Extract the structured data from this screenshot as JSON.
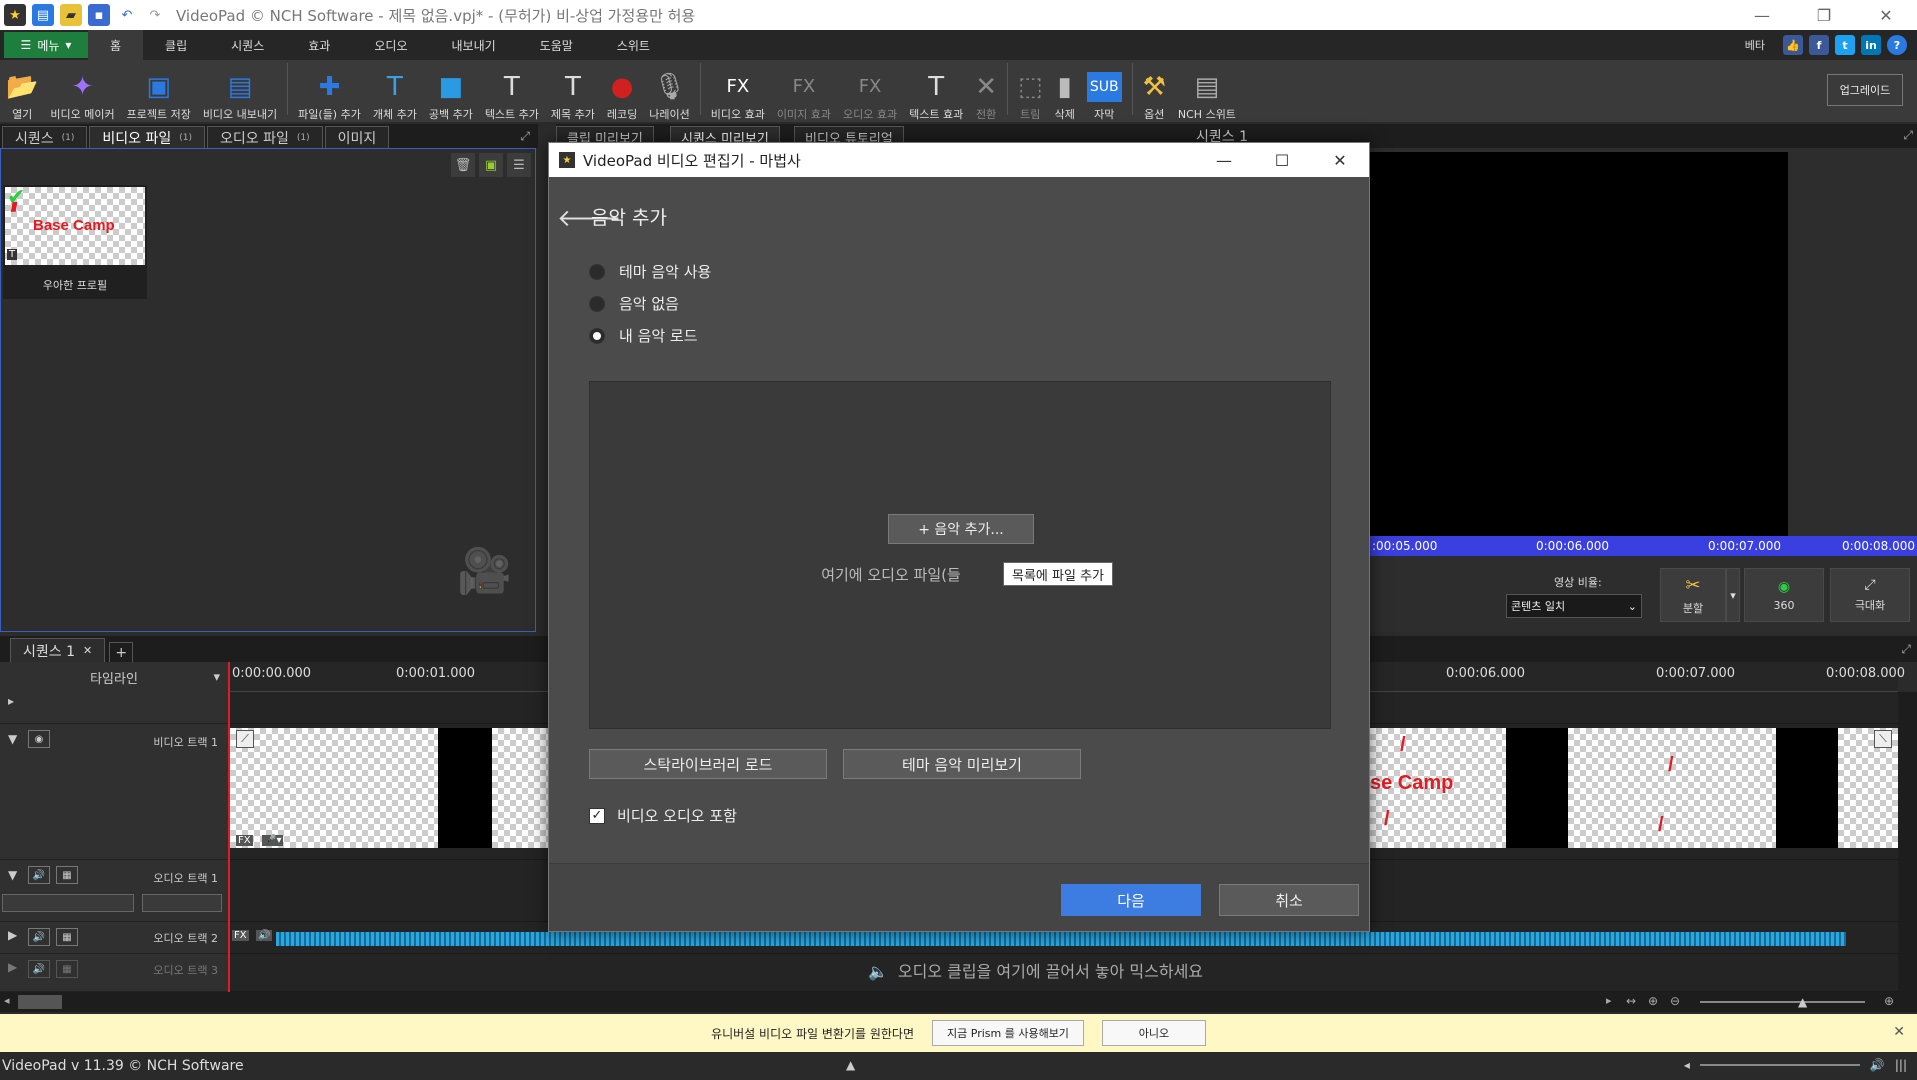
{
  "app": {
    "window_title": "VideoPad © NCH Software - 제목 없음.vpj* - (무허가) 비-상업 가정용만 허용"
  },
  "menu": {
    "menu_label": "메뉴",
    "tabs": [
      "홈",
      "클립",
      "시퀀스",
      "효과",
      "오디오",
      "내보내기",
      "도움말",
      "스위트"
    ],
    "active_tab": "홈",
    "beta_label": "베타"
  },
  "toolbar": {
    "items": [
      {
        "label": "열기",
        "icon": "folder-open-icon",
        "glyph": "📂"
      },
      {
        "label": "비디오 메이커",
        "icon": "wizard-icon",
        "glyph": "🧙"
      },
      {
        "label": "프로젝트 저장",
        "icon": "save-icon",
        "glyph": "💾"
      },
      {
        "label": "비디오 내보내기",
        "icon": "export-video-icon",
        "glyph": "🎞"
      },
      {
        "label": "파일(들) 추가",
        "icon": "add-file-icon",
        "glyph": "➕"
      },
      {
        "label": "개체 추가",
        "icon": "add-object-icon",
        "glyph": "T"
      },
      {
        "label": "공백 추가",
        "icon": "add-blank-icon",
        "glyph": "▣"
      },
      {
        "label": "텍스트 추가",
        "icon": "add-text-icon",
        "glyph": "T"
      },
      {
        "label": "제목 추가",
        "icon": "add-title-icon",
        "glyph": "T"
      },
      {
        "label": "레코딩",
        "icon": "record-icon",
        "glyph": "●"
      },
      {
        "label": "나레이션",
        "icon": "microphone-icon",
        "glyph": "🎙"
      },
      {
        "label": "비디오 효과",
        "icon": "video-fx-icon",
        "glyph": "FX"
      },
      {
        "label": "이미지 효과",
        "icon": "image-fx-icon",
        "glyph": "FX",
        "dim": true
      },
      {
        "label": "오디오 효과",
        "icon": "audio-fx-icon",
        "glyph": "FX",
        "dim": true
      },
      {
        "label": "텍스트 효과",
        "icon": "text-fx-icon",
        "glyph": "T"
      },
      {
        "label": "전환",
        "icon": "transition-icon",
        "glyph": "✕",
        "dim": true
      },
      {
        "label": "트림",
        "icon": "trim-icon",
        "glyph": "⬚",
        "dim": true
      },
      {
        "label": "삭제",
        "icon": "trash-icon",
        "glyph": "🗑"
      },
      {
        "label": "자막",
        "icon": "subtitle-icon",
        "glyph": "SUB"
      },
      {
        "label": "옵션",
        "icon": "options-icon",
        "glyph": "🔧"
      },
      {
        "label": "NCH 스위트",
        "icon": "nch-suite-icon",
        "glyph": "▤"
      }
    ],
    "upgrade_label": "업그레이드"
  },
  "bin": {
    "tabs": [
      {
        "label": "시퀀스",
        "count": "(1)"
      },
      {
        "label": "비디오 파일",
        "count": "(1)"
      },
      {
        "label": "오디오 파일",
        "count": "(1)"
      },
      {
        "label": "이미지",
        "count": ""
      }
    ],
    "active_tab": "비디오 파일",
    "thumbnail": {
      "logo_text": "Base Camp",
      "label": "우아한 프로필"
    }
  },
  "preview": {
    "tabs": [
      "클립 미리보기",
      "시퀀스 미리보기",
      "비디오 튜토리얼"
    ],
    "sequence_label": "시퀀스 1",
    "ruler_labels": [
      ":00:05.000",
      "0:00:06.000",
      "0:00:07.000",
      "0:00:08.000"
    ],
    "ratio_label": "영상 비율:",
    "ratio_value": "콘텐츠 일치",
    "split_label": "분할",
    "vr_label": "360",
    "fullscreen_label": "극대화"
  },
  "timeline": {
    "seq_tab": "시퀀스 1",
    "header_label": "타임라인",
    "ruler_labels": [
      "0:00:00.000",
      "0:00:01.000",
      "0:00:06.000",
      "0:00:07.000",
      "0:00:08.000"
    ],
    "tracks": {
      "video1": "비디오 트랙 1",
      "audio1": "오디오 트랙 1",
      "audio2": "오디오 트랙 2",
      "audio3": "오디오 트랙 3"
    },
    "clip_logo": "se Camp",
    "mix_hint": "오디오 클립을 여기에 끌어서 놓아 믹스하세요"
  },
  "notify": {
    "message": "유니버설 비디오 파일 변환기를 원한다면",
    "try_label": "지금 Prism 를 사용해보기",
    "no_label": "아니오"
  },
  "status": {
    "version": "VideoPad v 11.39 © NCH Software"
  },
  "dialog": {
    "title": "VideoPad 비디오 편집기 - 마법사",
    "heading": "음악 추가",
    "options": [
      {
        "label": "테마 음악 사용",
        "selected": false
      },
      {
        "label": "음악 없음",
        "selected": false
      },
      {
        "label": "내 음악 로드",
        "selected": true
      }
    ],
    "add_music_label": "+ 음악 추가...",
    "drop_hint": "여기에 오디오 파일(들",
    "tooltip": "목록에 파일 추가",
    "stock_library_label": "스탁라이브러리 로드",
    "theme_preview_label": "테마 음악 미리보기",
    "include_audio_label": "비디오 오디오 포함",
    "include_audio_checked": true,
    "next_label": "다음",
    "cancel_label": "취소"
  }
}
